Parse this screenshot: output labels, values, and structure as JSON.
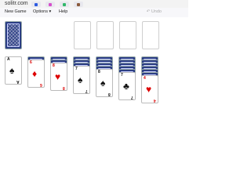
{
  "site": "solitr.com",
  "themes": [
    {
      "name": "blue-theme-icon",
      "color": "#2d5be0"
    },
    {
      "name": "pink-theme-icon",
      "color": "#d64fcb"
    },
    {
      "name": "green-theme-icon",
      "color": "#32b86a"
    },
    {
      "name": "brown-theme-icon",
      "color": "#8a5a3c"
    }
  ],
  "menu": {
    "new_game": "New Game",
    "options": "Options ▾",
    "help": "Help",
    "undo": "↶ Undo"
  },
  "tableau": [
    {
      "face_down": 0,
      "up": {
        "rank": "A",
        "suit": "♠",
        "color": "black"
      }
    },
    {
      "face_down": 1,
      "up": {
        "rank": "6",
        "suit": "♦",
        "color": "red"
      }
    },
    {
      "face_down": 2,
      "up": {
        "rank": "8",
        "suit": "♥",
        "color": "red"
      }
    },
    {
      "face_down": 3,
      "up": {
        "rank": "7",
        "suit": "♠",
        "color": "black"
      }
    },
    {
      "face_down": 4,
      "up": {
        "rank": "8",
        "suit": "♠",
        "color": "black"
      }
    },
    {
      "face_down": 5,
      "up": {
        "rank": "7",
        "suit": "♣",
        "color": "black"
      }
    },
    {
      "face_down": 6,
      "up": {
        "rank": "4",
        "suit": "♥",
        "color": "red"
      }
    }
  ]
}
